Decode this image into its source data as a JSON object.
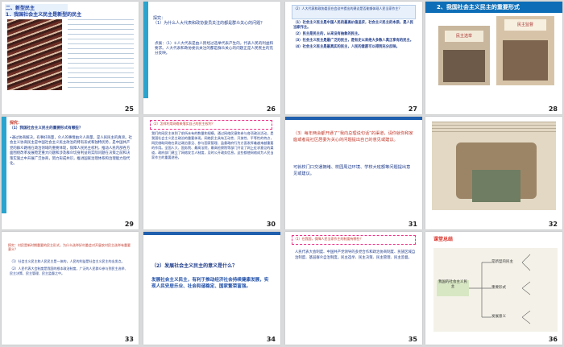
{
  "slides": [
    {
      "num": "25",
      "header_a": "二、新型民主",
      "header_b": "1．我国社会主义民主是新型的民主"
    },
    {
      "num": "26",
      "title": "探究：",
      "line1": "（1）为什么人大代表和政协委员关注的都是群众关心的问题？",
      "line2": "点拨：（1）①人大代表是由人民经过选举代表产生的，代表人民的利益和要求。人大代表和政协委员关注的都是群众关心的问题正是人民民主的充分反映。"
    },
    {
      "num": "27",
      "head": "（2）人大代表和政协委员在会议中提出的建议是否能够体现人民当家作主？",
      "line1": "（1）社会主义民主是中国人民的最高价值追求，社会主义民主的本质，是人民当家作主。",
      "line2": "（2）民主是民主的，从来没有抽象的民主。",
      "line3": "（3）社会主义民主是最广泛的民主，是有史以来绝大多数人真正享有的民主。",
      "line4": "（4）社会主义民主是最真实的民主，人民的意愿可以得到充分反映。"
    },
    {
      "num": "28",
      "title": "2、我国社会主义民主的重要形式",
      "poster1": "民主选举",
      "poster2": "民主监督"
    },
    {
      "num": "29",
      "label": "探究：",
      "q": "（1）我国社会主义民主的重要形式有哪些？",
      "body": "•通过协商解决，有事好商量，众人的事情由众人商量，是人民民主的真谛。社会主义协商民主是中国社会主义民主政治的特有形式和独特优势，是中国共产党的群众路线在政治领域的重要体现，保障人民民主权利，推动人民内部各方面围绕改革发展稳定重大问题和涉及群众切身利益的实际问题在决策之前和决策实施之中开展广泛协商，努力形成共识，推进国家治理体系和治理能力现代化。"
    },
    {
      "num": "30",
      "head": "（2）怎样利用网络来落实自己的民主权利？",
      "body": "我们的网民主体到了前所未有的数量和规模，通过网络民意和参与各项政治活动，是我国社会主义民主政治的重要体现。网络民主具有互动性、开放性、平等性的特点，网民借助网络在表达政治意见、参与国家管理、监督政府行为方面发挥着越来越重要的作用。全国人大、国务院、最高法院、最高检察院等部门开设了网上征求意见的渠道，政府部门建立了网络发言人制度，及时公开政务信息。这些都使网络成为人民当家作主的重要途径。"
    },
    {
      "num": "31",
      "q": "（3）每年两会都开通了“我向总理说句话”的渠道，请你就你和家庭或者是社区居委为关心的问题提出自己的意见或建议。",
      "a": "可就校门口交通拥堵、校园周边环境、学校大班额等问题提出意见或建议。"
    },
    {
      "num": "32"
    },
    {
      "num": "33",
      "head": "探究：村民是新时期重要的民主形式，为什么选举好村委会对开展农村民主选举有重要意义？",
      "line1": "（1）社会主义民主和人民民主是一体的，人民的利益是社会主义民主的出发点。",
      "line2": "（2）人民代表大会制度是我国的根本政治制度，广泛的人民群众参与到民主选举、民主决策、民主管理、民主监督之中。"
    },
    {
      "num": "34",
      "q": "（2）发展社会主义民主的意义是什么？",
      "a": "发展社会主义民主，有利于推动经济社会持续健康发展，实现人民安居乐业、社会和谐稳定、国家繁荣富强。"
    },
    {
      "num": "35",
      "head": "（1）在我国，保障人民当家作主的制度有哪些？",
      "body": "人民代表大会制度、中国共产党领导的多党合作和政治协商制度、民族区域自治制度、基层群众自治制度。民主选举、民主决策、民主管理、民主监督。"
    },
    {
      "num": "36",
      "title": "课堂总结",
      "root": "我国的社会主义民主",
      "b1": "是新型的民主",
      "b2": "重要形式",
      "b3": "发展意义"
    }
  ],
  "colors": {
    "accent": "#2aa4ce",
    "title_blue": "#1b3ea0",
    "red": "#d9342b",
    "page_bg": "#d9dadb"
  }
}
